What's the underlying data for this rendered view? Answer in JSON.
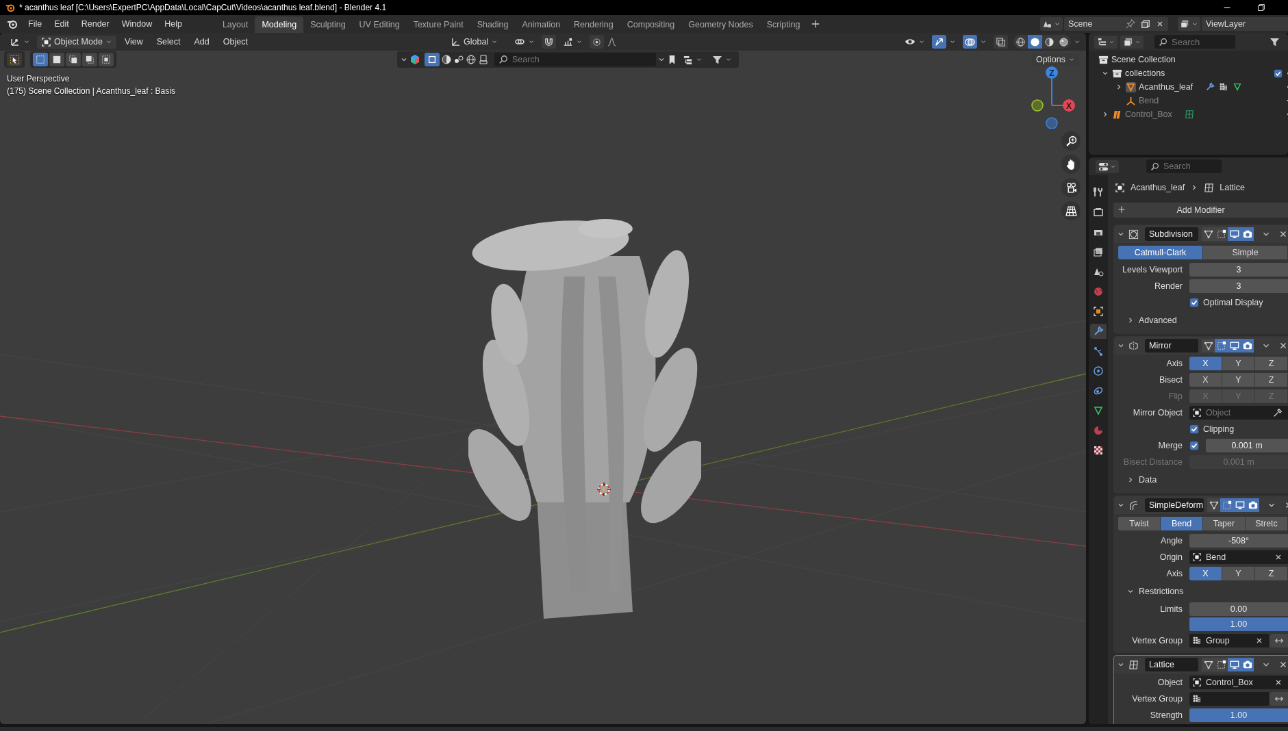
{
  "window": {
    "title": "* acanthus leaf [C:\\Users\\ExpertPC\\AppData\\Local\\CapCut\\Videos\\acanthus leaf.blend] - Blender 4.1"
  },
  "menu": [
    "File",
    "Edit",
    "Render",
    "Window",
    "Help"
  ],
  "workspaces": [
    {
      "label": "Layout",
      "selected": false
    },
    {
      "label": "Modeling",
      "selected": true
    },
    {
      "label": "Sculpting",
      "selected": false
    },
    {
      "label": "UV Editing",
      "selected": false
    },
    {
      "label": "Texture Paint",
      "selected": false
    },
    {
      "label": "Shading",
      "selected": false
    },
    {
      "label": "Animation",
      "selected": false
    },
    {
      "label": "Rendering",
      "selected": false
    },
    {
      "label": "Compositing",
      "selected": false
    },
    {
      "label": "Geometry Nodes",
      "selected": false
    },
    {
      "label": "Scripting",
      "selected": false
    }
  ],
  "scene": {
    "name": "Scene"
  },
  "view_layer": {
    "name": "ViewLayer"
  },
  "viewport": {
    "mode": "Object Mode",
    "menus": [
      "View",
      "Select",
      "Add",
      "Object"
    ],
    "orientation": "Global",
    "select_modes": [
      {
        "selected": true
      },
      {
        "selected": false
      },
      {
        "selected": false
      },
      {
        "selected": false
      },
      {
        "selected": false
      }
    ],
    "gizmos_on": true,
    "overlays_on": true,
    "shading": [
      {
        "kind": "wireframe",
        "selected": false
      },
      {
        "kind": "solid",
        "selected": true
      },
      {
        "kind": "material",
        "selected": false
      },
      {
        "kind": "rendered",
        "selected": false
      }
    ],
    "search": {
      "placeholder": "Search"
    },
    "options": "Options",
    "perspective": "User Perspective",
    "info": "(175) Scene Collection | Acanthus_leaf : Basis",
    "gizmo_axes": [
      "Z",
      "X"
    ]
  },
  "outliner": {
    "search": {
      "placeholder": "Search"
    },
    "tree": [
      {
        "label": "Scene Collection",
        "kind": "scene",
        "dimmed": false,
        "children": [
          {
            "label": "collections",
            "kind": "collection",
            "expanded": true,
            "dimmed": false,
            "children": [
              {
                "label": "Acanthus_leaf",
                "kind": "mesh",
                "expanded": false,
                "dimmed": false
              },
              {
                "label": "Bend",
                "kind": "empty",
                "dimmed": true
              }
            ]
          },
          {
            "label": "Control_Box",
            "kind": "lattice",
            "expanded": false,
            "dimmed": true
          }
        ]
      }
    ]
  },
  "properties": {
    "search": {
      "placeholder": "Search"
    },
    "tabs": [
      {
        "kind": "tool",
        "selected": false
      },
      {
        "kind": "render",
        "selected": false
      },
      {
        "kind": "output",
        "selected": false
      },
      {
        "kind": "view_layer",
        "selected": false
      },
      {
        "kind": "scene",
        "selected": false
      },
      {
        "kind": "world",
        "selected": false
      },
      {
        "kind": "object",
        "selected": false
      },
      {
        "kind": "modifiers",
        "selected": true
      },
      {
        "kind": "particles",
        "selected": false
      },
      {
        "kind": "physics",
        "selected": false
      },
      {
        "kind": "constraints",
        "selected": false
      },
      {
        "kind": "data",
        "selected": false
      },
      {
        "kind": "material",
        "selected": false
      },
      {
        "kind": "texture",
        "selected": false
      }
    ],
    "breadcrumb": [
      {
        "label": "Acanthus_leaf",
        "kind": "object"
      },
      {
        "label": "Lattice",
        "kind": "lattice"
      }
    ],
    "add_modifier": "Add Modifier",
    "modifiers": [
      {
        "name": "Subdivision",
        "kind": "subdivision",
        "expanded": true,
        "active": false,
        "toggles": {
          "on_cage": false,
          "edit_mode": false,
          "viewport": true,
          "render": true
        },
        "rows": [
          {
            "kind": "choice",
            "disabled": false,
            "options": [
              {
                "label": "Catmull-Clark",
                "selected": true
              },
              {
                "label": "Simple",
                "selected": false
              }
            ]
          },
          {
            "kind": "number",
            "label": "Levels Viewport",
            "value": "3",
            "disabled": false
          },
          {
            "kind": "number",
            "label": "Render",
            "value": "3",
            "disabled": false
          },
          {
            "kind": "checkbox",
            "label": "Optimal Display",
            "checked": true
          },
          {
            "kind": "subpanel",
            "label": "Advanced",
            "expanded": false
          }
        ]
      },
      {
        "name": "Mirror",
        "kind": "mirror",
        "expanded": true,
        "active": false,
        "toggles": {
          "on_cage": false,
          "edit_mode": true,
          "viewport": true,
          "render": true
        },
        "rows": [
          {
            "kind": "choice",
            "label": "Axis",
            "disabled": false,
            "options": [
              {
                "label": "X",
                "selected": true
              },
              {
                "label": "Y",
                "selected": false
              },
              {
                "label": "Z",
                "selected": false
              }
            ]
          },
          {
            "kind": "choice",
            "label": "Bisect",
            "disabled": false,
            "options": [
              {
                "label": "X",
                "selected": false
              },
              {
                "label": "Y",
                "selected": false
              },
              {
                "label": "Z",
                "selected": false
              }
            ]
          },
          {
            "kind": "choice",
            "label": "Flip",
            "disabled": true,
            "options": [
              {
                "label": "X",
                "selected": false
              },
              {
                "label": "Y",
                "selected": false
              },
              {
                "label": "Z",
                "selected": false
              }
            ]
          },
          {
            "kind": "object_field",
            "label": "Mirror Object",
            "placeholder": "Object",
            "eyedropper": true
          },
          {
            "kind": "checkbox",
            "label": "Clipping",
            "checked": true
          },
          {
            "kind": "check_number",
            "label": "Merge",
            "checked": true,
            "value": "0.001 m"
          },
          {
            "kind": "number",
            "label": "Bisect Distance",
            "value": "0.001 m",
            "disabled": true
          },
          {
            "kind": "subpanel",
            "label": "Data",
            "expanded": false
          }
        ]
      },
      {
        "name": "SimpleDeform",
        "kind": "simple_deform",
        "expanded": true,
        "active": false,
        "toggles": {
          "on_cage": false,
          "edit_mode": true,
          "viewport": true,
          "render": true
        },
        "rows": [
          {
            "kind": "choice",
            "disabled": false,
            "options": [
              {
                "label": "Twist",
                "selected": false
              },
              {
                "label": "Bend",
                "selected": true
              },
              {
                "label": "Taper",
                "selected": false
              },
              {
                "label": "Stretc",
                "selected": false
              }
            ]
          },
          {
            "kind": "number",
            "label": "Angle",
            "value": "-508°",
            "disabled": false
          },
          {
            "kind": "object_field",
            "label": "Origin",
            "value": "Bend",
            "clear": true
          },
          {
            "kind": "choice",
            "label": "Axis",
            "disabled": false,
            "options": [
              {
                "label": "X",
                "selected": true
              },
              {
                "label": "Y",
                "selected": false
              },
              {
                "label": "Z",
                "selected": false
              }
            ]
          },
          {
            "kind": "subpanel",
            "label": "Restrictions",
            "expanded": true
          },
          {
            "kind": "number",
            "label": "Limits",
            "value": "0.00",
            "disabled": false
          },
          {
            "kind": "number",
            "value": "1.00",
            "level": 1,
            "disabled": false
          },
          {
            "kind": "vertex_group_field",
            "label": "Vertex Group",
            "value": "Group",
            "clear": true,
            "invert": true
          }
        ]
      },
      {
        "name": "Lattice",
        "kind": "lattice",
        "expanded": true,
        "active": true,
        "toggles": {
          "on_cage": false,
          "edit_mode": false,
          "viewport": true,
          "render": true
        },
        "rows": [
          {
            "kind": "object_field",
            "label": "Object",
            "value": "Control_Box",
            "clear": true
          },
          {
            "kind": "vertex_group_field",
            "label": "Vertex Group",
            "invert": true
          },
          {
            "kind": "number",
            "label": "Strength",
            "value": "1.00",
            "level": 1,
            "disabled": false
          }
        ]
      }
    ]
  }
}
